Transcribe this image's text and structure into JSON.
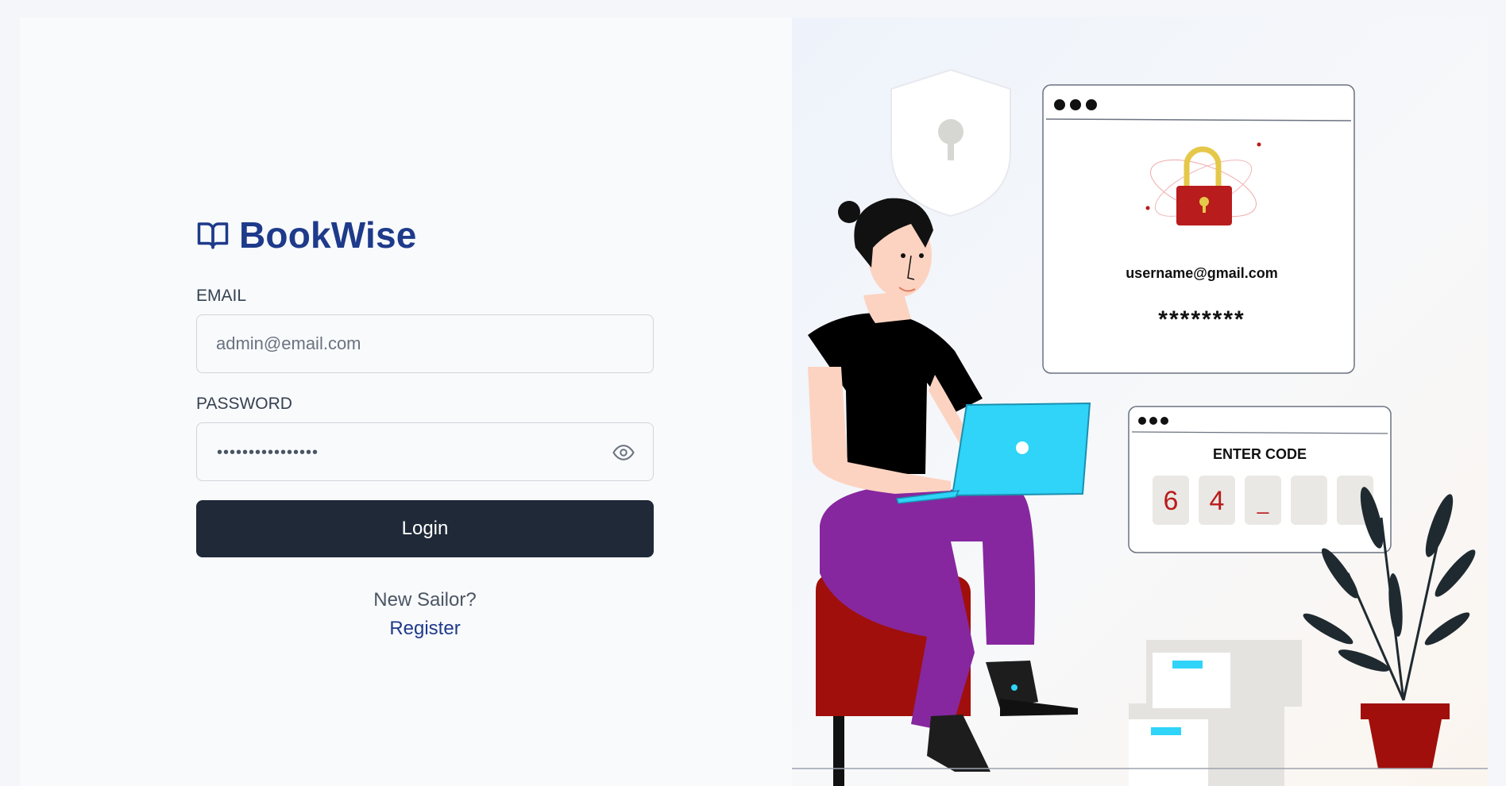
{
  "brand": {
    "name": "BookWise",
    "icon": "open-book-icon",
    "color": "#1e3a8a"
  },
  "form": {
    "email_label": "EMAIL",
    "email_placeholder": "admin@email.com",
    "password_label": "PASSWORD",
    "password_masked": "••••••••••••••••",
    "show_password_icon": "eye-icon",
    "login_label": "Login"
  },
  "footer": {
    "prompt": "New Sailor?",
    "register_label": "Register"
  },
  "illustration": {
    "credentials_email": "username@gmail.com",
    "credentials_password": "********",
    "code_title": "ENTER CODE",
    "code_digits": [
      "6",
      "4",
      "_",
      "",
      ""
    ]
  },
  "colors": {
    "button": "#1f2937",
    "accent": "#1e3a8a",
    "lock_red": "#b91c1c",
    "laptop": "#2fd4f8"
  }
}
